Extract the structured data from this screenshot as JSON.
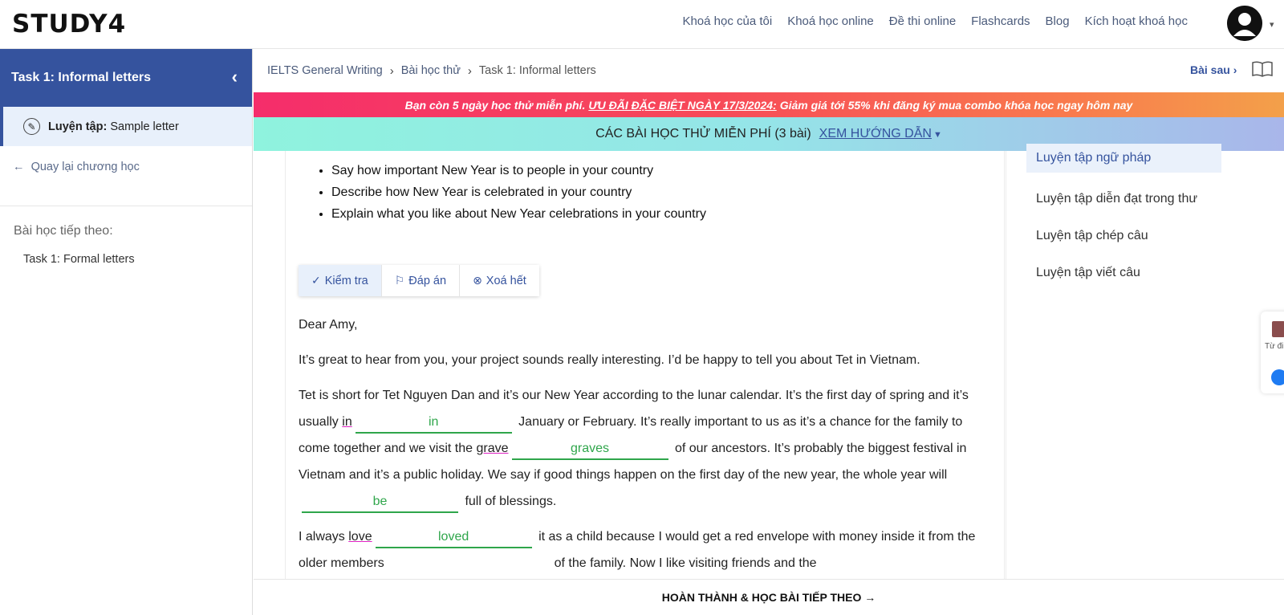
{
  "app": {
    "logo": "STUDY4"
  },
  "nav": {
    "links": [
      "Khoá học của tôi",
      "Khoá học online",
      "Đề thi online",
      "Flashcards",
      "Blog",
      "Kích hoạt khoá học"
    ]
  },
  "sidebar": {
    "title": "Task 1: Informal letters",
    "current_item_prefix": "Luyện tập:",
    "current_item_label": "Sample letter",
    "back_link": "Quay lại chương học",
    "next_label": "Bài học tiếp theo:",
    "next_item": "Task 1: Formal letters"
  },
  "breadcrumb": {
    "items": [
      "IELTS General Writing",
      "Bài học thử",
      "Task 1: Informal letters"
    ],
    "next_lesson": "Bài sau"
  },
  "promo": {
    "prefix": "Bạn còn 5 ngày học thử miễn phí.",
    "highlight": "ƯU ĐÃI ĐẶC BIỆT NGÀY 17/3/2024:",
    "suffix": "Giảm giá tới 55% khi đăng ký mua combo khóa học ngay hôm nay"
  },
  "free_lessons": {
    "text": "CÁC BÀI HỌC THỬ MIỄN PHÍ (3 bài)",
    "guide": "XEM HƯỚNG DẪN"
  },
  "task": {
    "bullets": [
      "Say how important New Year is to people in your country",
      "Describe how New Year is celebrated in your country",
      "Explain what you like about New Year celebrations in your country"
    ],
    "buttons": {
      "check": "Kiểm tra",
      "answer": "Đáp án",
      "clear": "Xoá hết"
    }
  },
  "passage": {
    "greeting": "Dear Amy,",
    "p1": "It’s great to hear from you, your project sounds really interesting. I’d be happy to tell you about Tet in Vietnam.",
    "p2_a": "Tet is short for Tet Nguyen Dan and it’s our New Year according to the lunar calendar. It’s the first day of spring and it’s usually",
    "p2_w1": "in",
    "p2_ans1": "in",
    "p2_b": "January or February. It’s really important to us as it’s a chance for the family to come together and we visit the",
    "p2_w2": "grave",
    "p2_ans2": "graves",
    "p2_c": "of our ancestors. It’s probably the biggest festival in Vietnam and it’s a public holiday. We say if good things happen on the first day of the new year, the whole year will",
    "p2_ans3": "be",
    "p2_d": "full of blessings.",
    "p3_a": "I always",
    "p3_w1": "love",
    "p3_ans1": "loved",
    "p3_b": "it as a child because I would get a red envelope with money inside it from the older members",
    "p3_c": "of the family. Now I like visiting friends and the"
  },
  "right_panel": {
    "items": [
      "Luyện tập ngữ pháp",
      "Luyện tập diễn đạt trong thư",
      "Luyện tập chép câu",
      "Luyện tập viết câu"
    ]
  },
  "float_widget": {
    "dict_label": "Từ đi"
  },
  "footer": {
    "label": "HOÀN THÀNH & HỌC BÀI TIẾP THEO →"
  },
  "colors": {
    "primary": "#35539e",
    "answer": "#2fa64b",
    "wrong_underline": "#e023c4"
  }
}
